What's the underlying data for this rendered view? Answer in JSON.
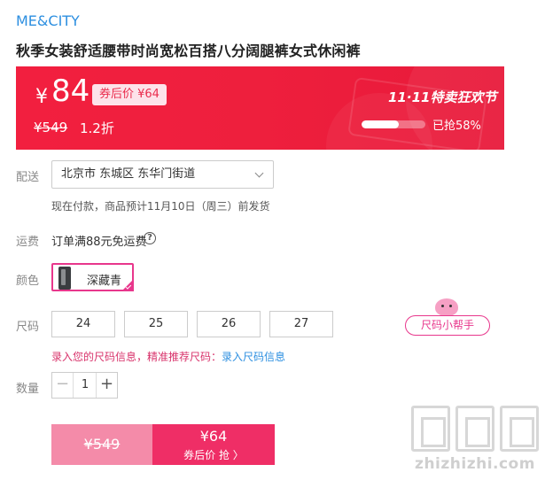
{
  "brand": "ME&CITY",
  "product_title": "秋季女装舒适腰带时尚宽松百搭八分阔腿裤女式休闲裤",
  "banner": {
    "currency": "¥",
    "price": "84",
    "coupon_price": "券后价 ¥64",
    "original_price": "¥549",
    "discount": "1.2折",
    "festival": "11·11特卖狂欢节",
    "sold_text": "已抢58%",
    "sold_progress": 0.58
  },
  "delivery": {
    "label": "配送",
    "address": "北京市 东城区 东华门街道",
    "note": "现在付款，商品预计11月10日（周三）前发货"
  },
  "freight": {
    "label": "运费",
    "text": "订单满88元免运费",
    "help_glyph": "?"
  },
  "color": {
    "label": "颜色",
    "selected": "深藏青"
  },
  "size": {
    "label": "尺码",
    "options": [
      "24",
      "25",
      "26",
      "27"
    ],
    "helper": "尺码小帮手",
    "tip": "录入您的尺码信息，精准推荐尺码：",
    "tip_link": "录入尺码信息"
  },
  "quantity": {
    "label": "数量",
    "minus": "−",
    "value": "1",
    "plus": "+"
  },
  "buy": {
    "original": "¥549",
    "price": "¥64",
    "action": "券后价 抢 〉"
  },
  "watermark": "zhizhizhi.com",
  "icons": {
    "help": "question-circle-icon",
    "dropdown": "chevron-down-icon",
    "check": "check-corner-icon"
  },
  "colors": {
    "brand_blue": "#2d8fe0",
    "banner_red": "#ef1f3e",
    "accent_pink": "#e8378c",
    "buy_pink": "#ef2e66",
    "buy_light": "#f48ba9"
  }
}
